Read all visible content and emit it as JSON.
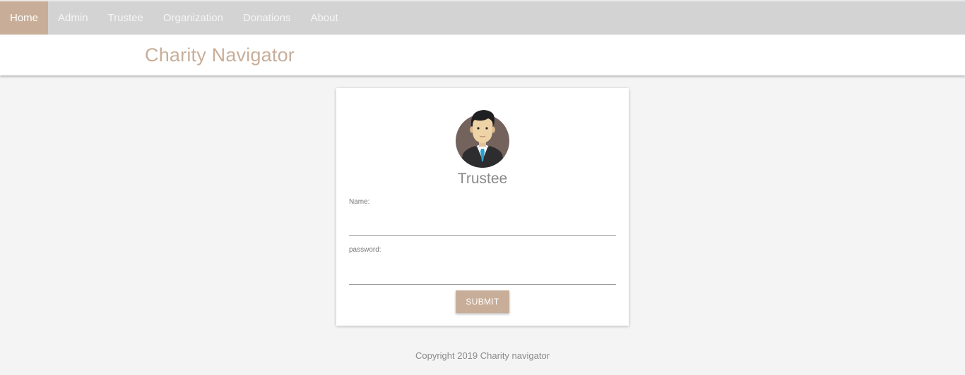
{
  "nav": {
    "items": [
      {
        "label": "Home",
        "active": true
      },
      {
        "label": "Admin",
        "active": false
      },
      {
        "label": "Trustee",
        "active": false
      },
      {
        "label": "Organization",
        "active": false
      },
      {
        "label": "Donations",
        "active": false
      },
      {
        "label": "About",
        "active": false
      }
    ]
  },
  "header": {
    "title": "Charity Navigator"
  },
  "login": {
    "avatar_icon": "trustee-avatar-icon",
    "title": "Trustee",
    "name_label": "Name:",
    "name_value": "",
    "password_label": "password:",
    "password_value": "",
    "submit_label": "SUBMIT"
  },
  "footer": {
    "copyright": "Copyright 2019 Charity navigator"
  },
  "colors": {
    "accent": "#c8ae99",
    "nav_bg": "#d3d3d3",
    "page_bg": "#f4f4f4"
  }
}
